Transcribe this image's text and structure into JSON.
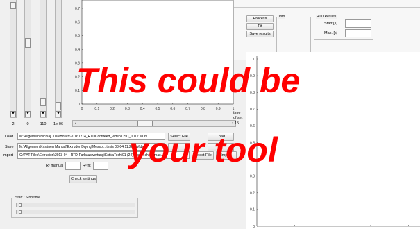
{
  "left_sliders": {
    "values": [
      "2",
      "0",
      "110",
      "1e-06"
    ]
  },
  "main_axes": {
    "y_ticks": [
      "0.7",
      "0.6",
      "0.5",
      "0.4",
      "0.3",
      "0.2",
      "0.1",
      "0"
    ],
    "x_ticks": [
      "0",
      "0.1",
      "0.2",
      "0.3",
      "0.4",
      "0.5",
      "0.6",
      "0.7",
      "0.8",
      "0.9",
      "1"
    ],
    "xlabel": "time"
  },
  "offset": {
    "label": "offset",
    "value": "15"
  },
  "file_rows": {
    "load": {
      "label": "Load",
      "path": "M:\\Allgemein\\Nicolaj Julia\\Bosch\\20161214_RTDConfifeed_Video\\DSC_0012.MOV",
      "select_label": "Select File",
      "action_label": "Load"
    },
    "save": {
      "label": "Save",
      "path": "M:\\Allgemein\\Kristinen Manual\\Extruder Drying\\Messpr...tests 03-04.11.20...\\Videos",
      "select_label": "",
      "action_label": ""
    },
    "import": {
      "label": "mport",
      "path": "C:\\PAT-Files\\Extrusion\\2013-04 - RTD-Farbauswertung\\ExtVaTech\\01 (24)...gen...cher...max...",
      "select_label": "Select File",
      "action_label": "Import"
    }
  },
  "r2": {
    "manual_label": "R² manual",
    "manual_value": "",
    "fit_label": "R² fit",
    "fit_value": ""
  },
  "check_settings_label": "Check settings",
  "start_stop": {
    "title": "Start / Stop time"
  },
  "right_controls": {
    "process_label": "Process",
    "fit_label": "Fit",
    "save_results_label": "Save results",
    "info_title": "Info",
    "rtd_title": "RTD Results",
    "start_label": "Start [s]",
    "start_value": "",
    "max_label": "Max. [s]",
    "max_value": ""
  },
  "right_axes": {
    "y_ticks": [
      "1",
      "0.9",
      "0.8",
      "0.7",
      "0.6",
      "0.5",
      "0.4",
      "0.3",
      "0.2",
      "0.1",
      "0"
    ]
  },
  "overlay": {
    "line1": "This could be",
    "line2": "your tool"
  },
  "colors": {
    "overlay": "#ff0000",
    "background": "#f0f0f0"
  }
}
